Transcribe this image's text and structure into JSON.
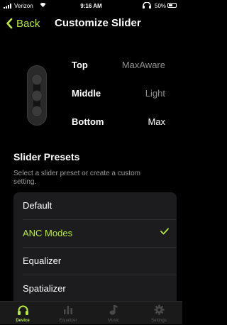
{
  "status_bar": {
    "carrier": "Verizon",
    "time": "9:16 AM",
    "battery": "50%"
  },
  "nav": {
    "back_label": "Back",
    "title": "Customize Slider"
  },
  "slider_positions": [
    {
      "label": "Top",
      "value": "MaxAware"
    },
    {
      "label": "Middle",
      "value": "Light"
    },
    {
      "label": "Bottom",
      "value": "Max"
    }
  ],
  "presets": {
    "title": "Slider Presets",
    "description": "Select a slider preset or create a custom setting.",
    "items": [
      {
        "label": "Default",
        "selected": false
      },
      {
        "label": "ANC Modes",
        "selected": true
      },
      {
        "label": "Equalizer",
        "selected": false
      },
      {
        "label": "Spatializer",
        "selected": false
      }
    ]
  },
  "tabs": [
    {
      "label": "Device",
      "icon": "headphones-icon",
      "active": true
    },
    {
      "label": "Equalizer",
      "icon": "equalizer-icon",
      "active": false
    },
    {
      "label": "Music",
      "icon": "music-note-icon",
      "active": false
    },
    {
      "label": "Settings",
      "icon": "gear-icon",
      "active": false
    }
  ],
  "colors": {
    "accent": "#b6ea3c",
    "background": "#000000",
    "list_bg": "#1c1c1e"
  }
}
